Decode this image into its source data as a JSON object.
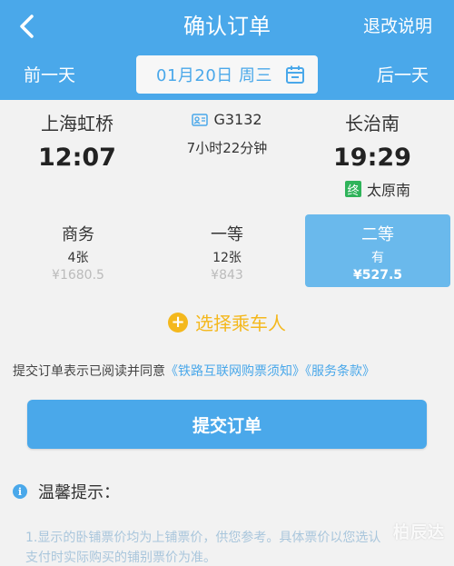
{
  "header": {
    "title": "确认订单",
    "refund_link": "退改说明",
    "prev_day": "前一天",
    "next_day": "后一天",
    "date": "01月20日 周三"
  },
  "train": {
    "from_station": "上海虹桥",
    "to_station": "长治南",
    "departure_time": "12:07",
    "arrival_time": "19:29",
    "train_number": "G3132",
    "duration": "7小时22分钟",
    "terminal_badge": "终",
    "terminal_station": "太原南"
  },
  "seats": [
    {
      "name": "商务",
      "count": "4张",
      "price": "¥1680.5"
    },
    {
      "name": "一等",
      "count": "12张",
      "price": "¥843"
    },
    {
      "name": "二等",
      "count": "有",
      "price": "¥527.5"
    }
  ],
  "add_passenger": {
    "label": "选择乘车人"
  },
  "agreement": {
    "prefix": "提交订单表示已阅读并同意",
    "link1": "《铁路互联网购票须知》",
    "link2": "《服务条款》"
  },
  "submit": {
    "label": "提交订单"
  },
  "tips": {
    "title": "温馨提示：",
    "line1": "1.显示的卧铺票价均为上铺票价，供您参考。具体票价以您选认",
    "line2": "支付时实际购买的铺别票价为准。"
  },
  "watermark": "柏辰达",
  "colors": {
    "primary": "#4aa8ea",
    "accent": "#f4b81d",
    "terminal_badge": "#2fb35a"
  }
}
